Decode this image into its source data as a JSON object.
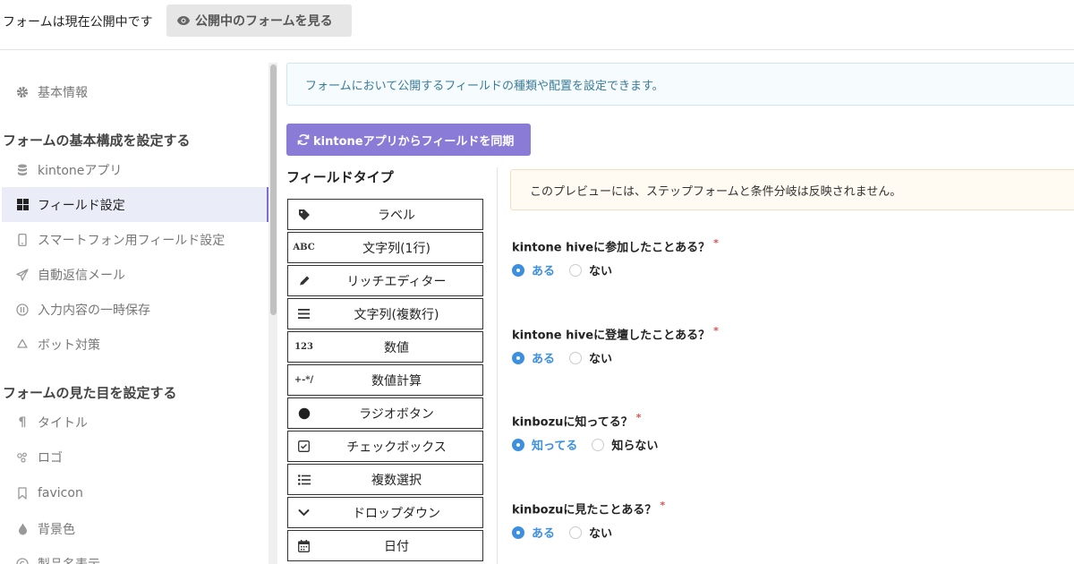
{
  "header": {
    "status_text": "フォームは現在公開中です",
    "view_button": "公開中のフォームを見る"
  },
  "sidebar": {
    "top_item": {
      "label": "基本情報",
      "icon": "gear-icon"
    },
    "section1_title": "フォームの基本構成を設定する",
    "section1_items": [
      {
        "label": "kintoneアプリ",
        "icon": "database-icon"
      },
      {
        "label": "フィールド設定",
        "icon": "grid-icon",
        "active": true
      },
      {
        "label": "スマートフォン用フィールド設定",
        "icon": "smartphone-icon"
      },
      {
        "label": "自動返信メール",
        "icon": "paper-plane-icon"
      },
      {
        "label": "入力内容の一時保存",
        "icon": "pause-circle-icon"
      },
      {
        "label": "ボット対策",
        "icon": "recycle-icon"
      }
    ],
    "section2_title": "フォームの見た目を設定する",
    "section2_items": [
      {
        "label": "タイトル",
        "icon": "paragraph-icon"
      },
      {
        "label": "ロゴ",
        "icon": "logo-icon"
      },
      {
        "label": "favicon",
        "icon": "bookmark-icon"
      },
      {
        "label": "背景色",
        "icon": "droplet-icon"
      },
      {
        "label": "製品名表示",
        "icon": "copyright-icon"
      }
    ]
  },
  "main": {
    "info_text": "フォームにおいて公開するフィールドの種類や配置を設定できます。",
    "sync_button": "kintoneアプリからフィールドを同期",
    "field_type_title": "フィールドタイプ",
    "field_types": [
      {
        "label": "ラベル",
        "icon": "tag-icon",
        "icon_text": ""
      },
      {
        "label": "文字列(1行)",
        "icon": "abc-icon",
        "icon_text": "ABC"
      },
      {
        "label": "リッチエディター",
        "icon": "pencil-icon",
        "icon_text": ""
      },
      {
        "label": "文字列(複数行)",
        "icon": "lines-icon",
        "icon_text": ""
      },
      {
        "label": "数値",
        "icon": "number-icon",
        "icon_text": "123"
      },
      {
        "label": "数値計算",
        "icon": "calc-icon",
        "icon_text": "+-*/"
      },
      {
        "label": "ラジオボタン",
        "icon": "radio-icon",
        "icon_text": ""
      },
      {
        "label": "チェックボックス",
        "icon": "checkbox-icon",
        "icon_text": ""
      },
      {
        "label": "複数選択",
        "icon": "list-icon",
        "icon_text": ""
      },
      {
        "label": "ドロップダウン",
        "icon": "chevron-down-icon",
        "icon_text": ""
      },
      {
        "label": "日付",
        "icon": "calendar-icon",
        "icon_text": ""
      }
    ],
    "preview_warning": "このプレビューには、ステップフォームと条件分岐は反映されません。",
    "questions": [
      {
        "label": "kintone hiveに参加したことある？",
        "required": "*",
        "selected": "ある",
        "other": "ない"
      },
      {
        "label": "kintone hiveに登壇したことある？",
        "required": "*",
        "selected": "ある",
        "other": "ない"
      },
      {
        "label": "kinbozuに知ってる？",
        "required": "*",
        "selected": "知ってる",
        "other": "知らない"
      },
      {
        "label": "kinbozuに見たことある？",
        "required": "*",
        "selected": "ある",
        "other": "ない"
      }
    ]
  },
  "colors": {
    "accent": "#8a7cd6",
    "active_bg": "#eaecf8",
    "radio_selected": "#3d8fe0",
    "required": "#d9534f"
  }
}
